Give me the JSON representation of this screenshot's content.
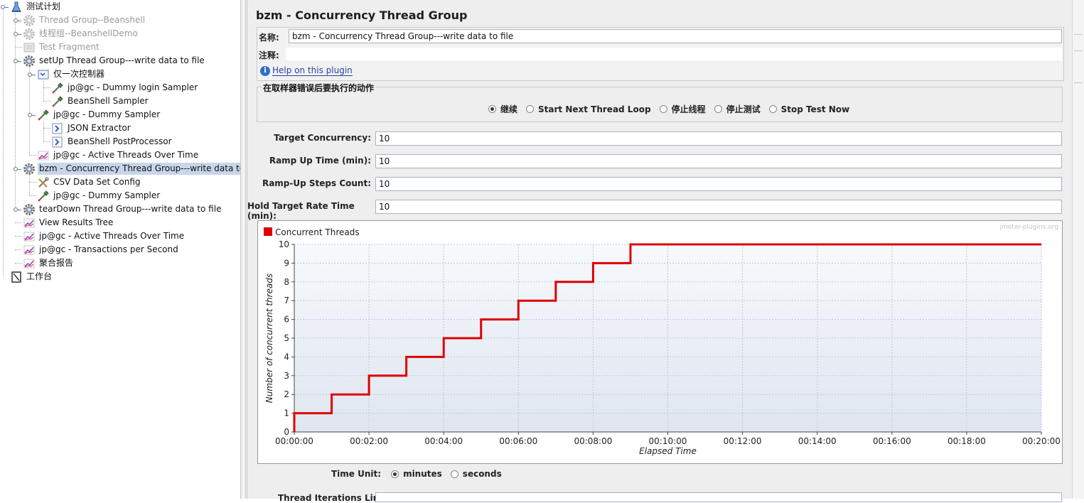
{
  "tree": {
    "items": [
      {
        "label": "测试计划",
        "icon": "test-plan-icon",
        "level": 0,
        "disabled": false,
        "selected": false
      },
      {
        "label": "Thread Group--Beanshell",
        "icon": "gear-icon",
        "level": 1,
        "disabled": true,
        "selected": false
      },
      {
        "label": "线程组--BeanshellDemo",
        "icon": "gear-icon",
        "level": 1,
        "disabled": true,
        "selected": false
      },
      {
        "label": "Test Fragment",
        "icon": "fragment-icon",
        "level": 1,
        "disabled": true,
        "selected": false
      },
      {
        "label": "setUp Thread Group---write data to file",
        "icon": "gear-icon",
        "level": 1,
        "disabled": false,
        "selected": false
      },
      {
        "label": "仅一次控制器",
        "icon": "controller-icon",
        "level": 2,
        "disabled": false,
        "selected": false
      },
      {
        "label": "jp@gc - Dummy login Sampler",
        "icon": "pipette-icon",
        "level": 3,
        "disabled": false,
        "selected": false
      },
      {
        "label": "BeanShell Sampler",
        "icon": "pipette-icon",
        "level": 3,
        "disabled": false,
        "selected": false
      },
      {
        "label": "jp@gc - Dummy Sampler",
        "icon": "pipette-icon",
        "level": 2,
        "disabled": false,
        "selected": false
      },
      {
        "label": "JSON Extractor",
        "icon": "postprocessor-icon",
        "level": 3,
        "disabled": false,
        "selected": false
      },
      {
        "label": "BeanShell PostProcessor",
        "icon": "postprocessor-icon",
        "level": 3,
        "disabled": false,
        "selected": false
      },
      {
        "label": "jp@gc - Active Threads Over Time",
        "icon": "graph-icon",
        "level": 2,
        "disabled": false,
        "selected": false
      },
      {
        "label": "bzm - Concurrency Thread Group---write data to file",
        "icon": "gear-icon",
        "level": 1,
        "disabled": false,
        "selected": true
      },
      {
        "label": "CSV Data Set Config",
        "icon": "config-icon",
        "level": 2,
        "disabled": false,
        "selected": false
      },
      {
        "label": "jp@gc - Dummy Sampler",
        "icon": "pipette-icon",
        "level": 2,
        "disabled": false,
        "selected": false
      },
      {
        "label": "tearDown Thread Group---write data to file",
        "icon": "gear-icon",
        "level": 1,
        "disabled": false,
        "selected": false
      },
      {
        "label": "View Results Tree",
        "icon": "graph-icon",
        "level": 1,
        "disabled": false,
        "selected": false
      },
      {
        "label": "jp@gc - Active Threads Over Time",
        "icon": "graph-icon",
        "level": 1,
        "disabled": false,
        "selected": false
      },
      {
        "label": "jp@gc - Transactions per Second",
        "icon": "graph-icon",
        "level": 1,
        "disabled": false,
        "selected": false
      },
      {
        "label": "聚合报告",
        "icon": "graph-icon",
        "level": 1,
        "disabled": false,
        "selected": false
      },
      {
        "label": "工作台",
        "icon": "workbench-icon",
        "level": 0,
        "disabled": false,
        "selected": false
      }
    ]
  },
  "panel": {
    "title": "bzm - Concurrency Thread Group",
    "name_label": "名称:",
    "name_value": "bzm - Concurrency Thread Group---write data to file",
    "comment_label": "注释:",
    "comment_value": "",
    "help_link": "Help on this plugin"
  },
  "error_action": {
    "legend": "在取样器错误后要执行的动作",
    "options": [
      {
        "label": "继续",
        "selected": true
      },
      {
        "label": "Start Next Thread Loop",
        "selected": false
      },
      {
        "label": "停止线程",
        "selected": false
      },
      {
        "label": "停止测试",
        "selected": false
      },
      {
        "label": "Stop Test Now",
        "selected": false
      }
    ]
  },
  "params": [
    {
      "label": "Target Concurrency:",
      "value": "10"
    },
    {
      "label": "Ramp Up Time (min):",
      "value": "10"
    },
    {
      "label": "Ramp-Up Steps Count:",
      "value": "10"
    },
    {
      "label": "Hold Target Rate Time (min):",
      "value": "10"
    }
  ],
  "time_unit": {
    "label": "Time Unit:",
    "options": [
      {
        "label": "minutes",
        "selected": true
      },
      {
        "label": "seconds",
        "selected": false
      }
    ]
  },
  "iterations": {
    "label": "Thread Iterations Limit:",
    "value": ""
  },
  "colors": {
    "series": "#dd0000",
    "selection": "#c7d6ea",
    "link": "#2344a8"
  },
  "chart_data": {
    "type": "line",
    "title": "",
    "watermark": "jmeter-plugins.org",
    "xlabel": "Elapsed Time",
    "ylabel": "Number of concurrent threads",
    "xlim": [
      0,
      20
    ],
    "ylim": [
      0,
      10
    ],
    "x_ticks": [
      "00:00:00",
      "00:02:00",
      "00:04:00",
      "00:06:00",
      "00:08:00",
      "00:10:00",
      "00:12:00",
      "00:14:00",
      "00:16:00",
      "00:18:00",
      "00:20:00"
    ],
    "y_ticks": [
      0,
      1,
      2,
      3,
      4,
      5,
      6,
      7,
      8,
      9,
      10
    ],
    "grid": true,
    "legend_position": "top-left",
    "series": [
      {
        "name": "Concurrent Threads",
        "color": "#dd0000",
        "step": true,
        "x": [
          0,
          0,
          1,
          2,
          3,
          4,
          5,
          6,
          7,
          8,
          9,
          20
        ],
        "y": [
          0,
          1,
          2,
          3,
          4,
          5,
          6,
          7,
          8,
          9,
          10,
          10
        ]
      }
    ]
  }
}
